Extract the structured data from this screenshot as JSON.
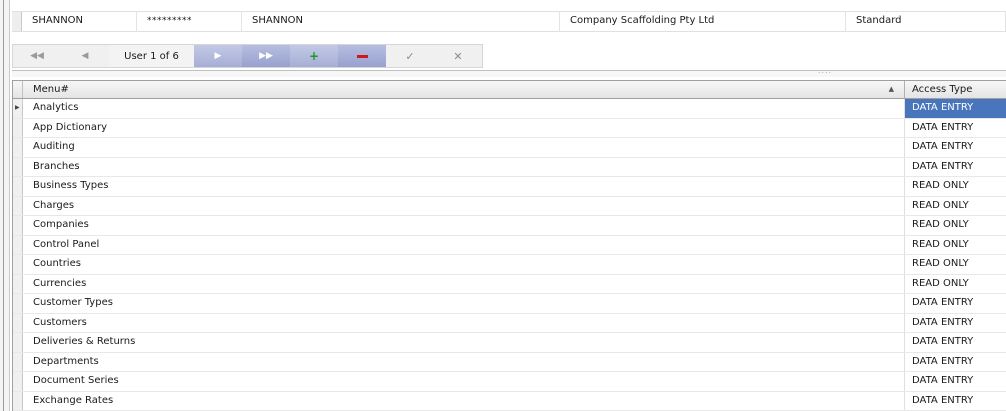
{
  "user_record": {
    "username": "SHANNON",
    "password": "*********",
    "full_name": "SHANNON",
    "company": "Company Scaffolding Pty Ltd",
    "user_type": "Standard"
  },
  "navigator": {
    "first_icon": "first-record-icon",
    "prev_icon": "previous-record-icon",
    "caption": "User 1 of 6",
    "next_icon": "next-record-icon",
    "last_icon": "last-record-icon",
    "insert_icon": "plus-icon",
    "delete_icon": "minus-icon",
    "post_icon": "checkmark-icon",
    "cancel_icon": "cancel-x-icon"
  },
  "grid": {
    "columns": [
      "Menu#",
      "Access Type"
    ],
    "rows": [
      {
        "menu": "Analytics",
        "access": "DATA ENTRY"
      },
      {
        "menu": "App Dictionary",
        "access": "DATA ENTRY"
      },
      {
        "menu": "Auditing",
        "access": "DATA ENTRY"
      },
      {
        "menu": "Branches",
        "access": "DATA ENTRY"
      },
      {
        "menu": "Business Types",
        "access": "READ ONLY"
      },
      {
        "menu": "Charges",
        "access": "READ ONLY"
      },
      {
        "menu": "Companies",
        "access": "READ ONLY"
      },
      {
        "menu": "Control Panel",
        "access": "READ ONLY"
      },
      {
        "menu": "Countries",
        "access": "READ ONLY"
      },
      {
        "menu": "Currencies",
        "access": "READ ONLY"
      },
      {
        "menu": "Customer Types",
        "access": "DATA ENTRY"
      },
      {
        "menu": "Customers",
        "access": "DATA ENTRY"
      },
      {
        "menu": "Deliveries & Returns",
        "access": "DATA ENTRY"
      },
      {
        "menu": "Departments",
        "access": "DATA ENTRY"
      },
      {
        "menu": "Document Series",
        "access": "DATA ENTRY"
      },
      {
        "menu": "Exchange Rates",
        "access": "DATA ENTRY"
      }
    ]
  },
  "colors": {
    "selection": "#4875bc",
    "nav_button": "#a6aed6",
    "insert": "#1e9a1e",
    "delete": "#cc1a1a"
  }
}
